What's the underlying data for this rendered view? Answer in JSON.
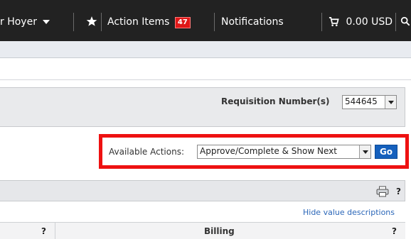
{
  "topbar": {
    "user_name": "r Hoyer",
    "action_items_label": "Action Items",
    "action_items_count": "47",
    "notifications_label": "Notifications",
    "cart_amount": "0.00 USD"
  },
  "requisition": {
    "label": "Requisition Number(s)",
    "selected": "544645"
  },
  "actions": {
    "label": "Available Actions:",
    "selected": "Approve/Complete & Show Next",
    "go_label": "Go"
  },
  "table": {
    "help_mark": "?",
    "hide_descriptions_label": "Hide value descriptions",
    "billing_header": "Billing"
  },
  "colors": {
    "topbar": "#222222",
    "badge": "#e01818",
    "highlight": "#ee1111",
    "go_button": "#1560bd",
    "link": "#2a66b8"
  }
}
